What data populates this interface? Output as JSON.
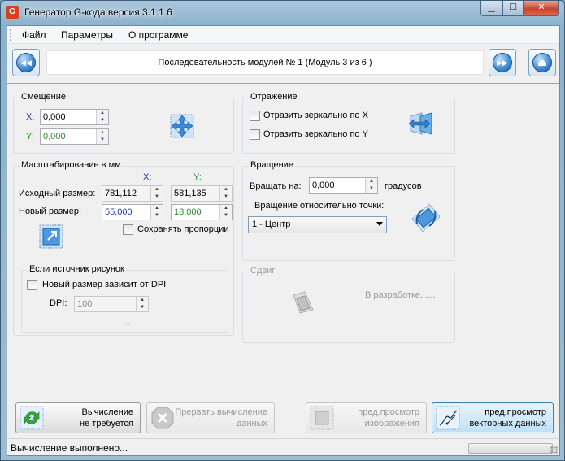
{
  "window": {
    "title": "Генератор G-кода версия 3.1.1.6",
    "app_icon": "G",
    "minimize_label": "▁",
    "maximize_label": "☐",
    "close_label": "✕"
  },
  "menu": {
    "items": [
      "Файл",
      "Параметры",
      "О программе"
    ]
  },
  "nav": {
    "sequence_label": "Последовательность модулей № 1 (Модуль 3 из 6 )",
    "prev_icon": "◀◀",
    "next_icon": "▶▶",
    "eject_icon": "⏏"
  },
  "offset": {
    "title": "Смещение",
    "x_label": "X:",
    "x_value": "0,000",
    "y_label": "Y:",
    "y_value": "0,000",
    "icon": "move-arrows-icon"
  },
  "reflection": {
    "title": "Отражение",
    "mirror_x_label": "Отразить зеркально по X",
    "mirror_y_label": "Отразить зеркально по Y",
    "icon": "mirror-arrows-icon"
  },
  "scaling": {
    "title": "Масштабирование в мм.",
    "col_x": "X:",
    "col_y": "Y:",
    "source_label": "Исходный размер:",
    "source_x": "781,112",
    "source_y": "581,135",
    "new_label": "Новый размер:",
    "new_x": "55,000",
    "new_y": "18,000",
    "keep_ratio_label": "Сохранять пропорции"
  },
  "image_source": {
    "title": "Если источник рисунок",
    "dpi_dependent_label": "Новый размер зависит от DPI",
    "dpi_label": "DPI:",
    "dpi_value": "100",
    "ellipsis": "..."
  },
  "rotation": {
    "title": "Вращение",
    "rotate_label": "Вращать на:",
    "rotate_value": "0,000",
    "degrees_label": "градусов",
    "pivot_label": "Вращение относительно точки:",
    "pivot_value": "1 - Центр"
  },
  "shift": {
    "title": "Сдвиг",
    "status": "В разработке......"
  },
  "actions": {
    "calc_label_1": "Вычисление",
    "calc_label_2": "не требуется",
    "abort_label_1": "Прервать вычисление",
    "abort_label_2": "данных",
    "preview_image_label_1": "пред.просмотр",
    "preview_image_label_2": "изображения",
    "preview_vector_label_1": "пред.просмотр",
    "preview_vector_label_2": "векторных данных"
  },
  "status": {
    "text": "Вычисление выполнено..."
  },
  "colors": {
    "accent_blue": "#1e3ea8",
    "value_green": "#2e8b2e",
    "active_button": "#bde0f7"
  }
}
